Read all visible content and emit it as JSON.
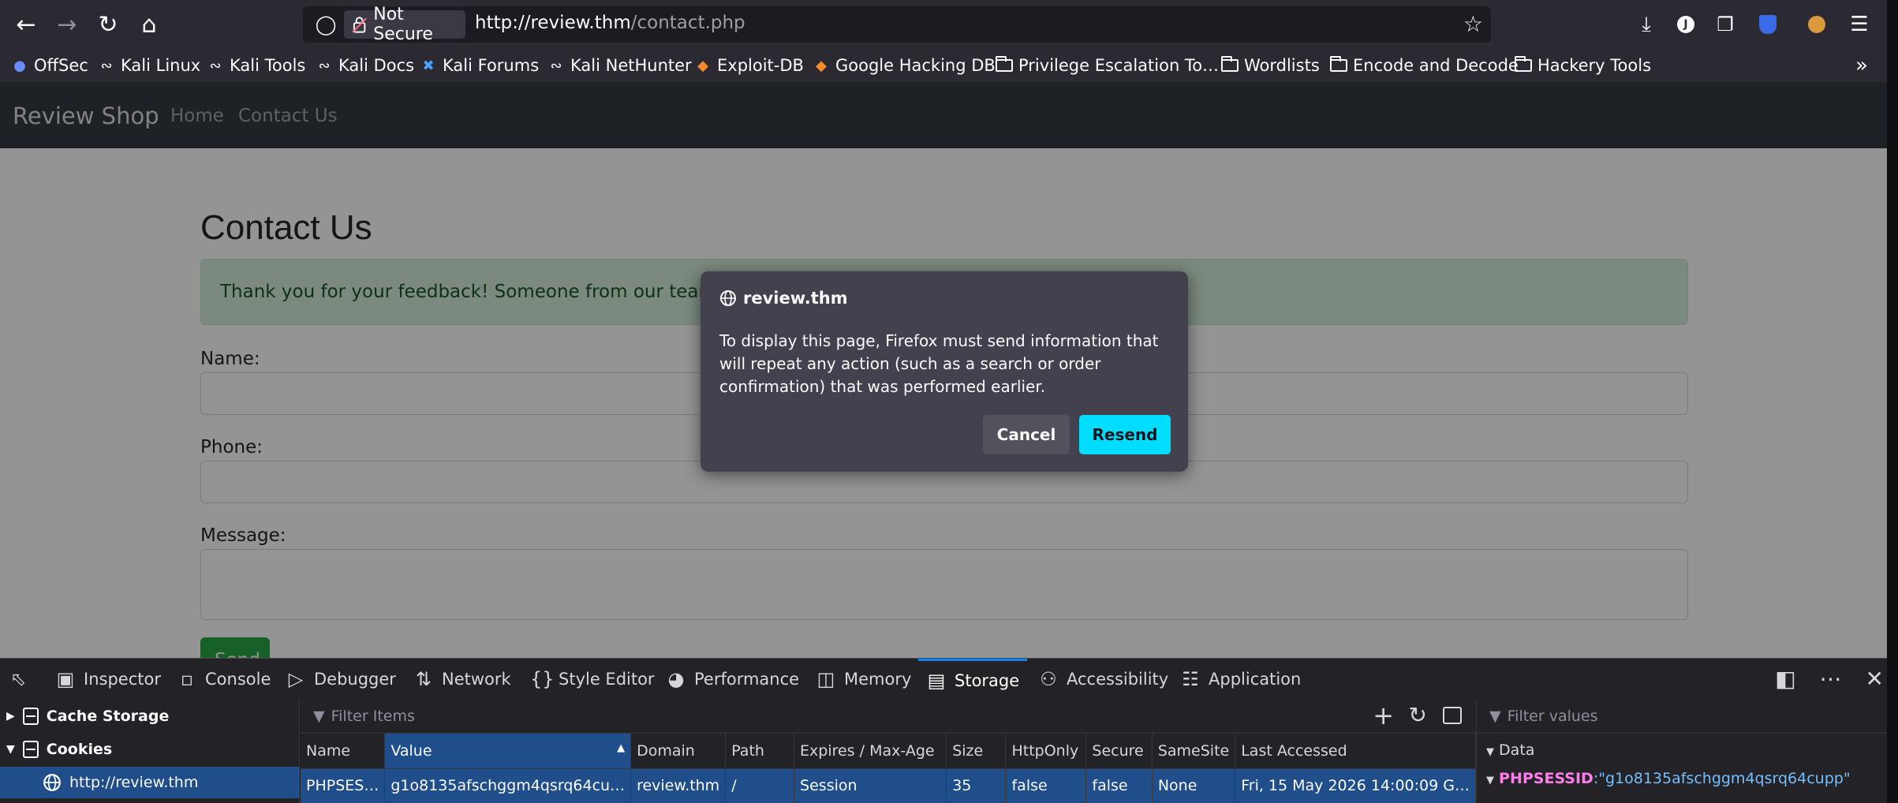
{
  "browser": {
    "security_label": "Not Secure",
    "url_host": "http://review.thm",
    "url_path": "/contact.php"
  },
  "bookmarks": [
    {
      "label": "OffSec",
      "icon": "offsec-icon"
    },
    {
      "label": "Kali Linux",
      "icon": "kali-dragon-icon"
    },
    {
      "label": "Kali Tools",
      "icon": "kali-dragon-icon"
    },
    {
      "label": "Kali Docs",
      "icon": "kali-dragon-icon"
    },
    {
      "label": "Kali Forums",
      "icon": "kali-forums-icon"
    },
    {
      "label": "Kali NetHunter",
      "icon": "kali-dragon-icon"
    },
    {
      "label": "Exploit-DB",
      "icon": "exploitdb-icon"
    },
    {
      "label": "Google Hacking DB",
      "icon": "exploitdb-icon"
    },
    {
      "label": "Privilege Escalation To…",
      "icon": "folder-icon"
    },
    {
      "label": "Wordlists",
      "icon": "folder-icon"
    },
    {
      "label": "Encode and Decode",
      "icon": "folder-icon"
    },
    {
      "label": "Hackery Tools",
      "icon": "folder-icon"
    }
  ],
  "site": {
    "brand": "Review Shop",
    "nav": [
      "Home",
      "Contact Us"
    ],
    "heading": "Contact Us",
    "alert": "Thank you for your feedback! Someone from our team will r",
    "labels": {
      "name": "Name:",
      "phone": "Phone:",
      "message": "Message:"
    },
    "send": "Send"
  },
  "dialog": {
    "host": "review.thm",
    "body": "To display this page, Firefox must send information that will repeat any action (such as a search or order confirmation) that was performed earlier.",
    "cancel": "Cancel",
    "resend": "Resend"
  },
  "devtools": {
    "tabs": [
      "Inspector",
      "Console",
      "Debugger",
      "Network",
      "Style Editor",
      "Performance",
      "Memory",
      "Storage",
      "Accessibility",
      "Application"
    ],
    "selected_tab": "Storage",
    "tree": {
      "cache": "Cache Storage",
      "cookies": "Cookies",
      "host": "http://review.thm"
    },
    "filter_items": "Filter Items",
    "filter_values": "Filter values",
    "columns": [
      "Name",
      "Value",
      "Domain",
      "Path",
      "Expires / Max-Age",
      "Size",
      "HttpOnly",
      "Secure",
      "SameSite",
      "Last Accessed"
    ],
    "row": [
      "PHPSES…",
      "g1o8135afschggm4qsrq64cu…",
      "review.thm",
      "/",
      "Session",
      "35",
      "false",
      "false",
      "None",
      "Fri, 15 May 2026 14:00:09 G…"
    ],
    "data_label": "Data",
    "data_key": "PHPSESSID",
    "data_value": ":\"g1o8135afschggm4qsrq64cupp\""
  },
  "colors": {
    "accent": "#0a84ff",
    "resend": "#00ddff",
    "alert_bg": "#d4edda",
    "navbar": "#343a40"
  }
}
